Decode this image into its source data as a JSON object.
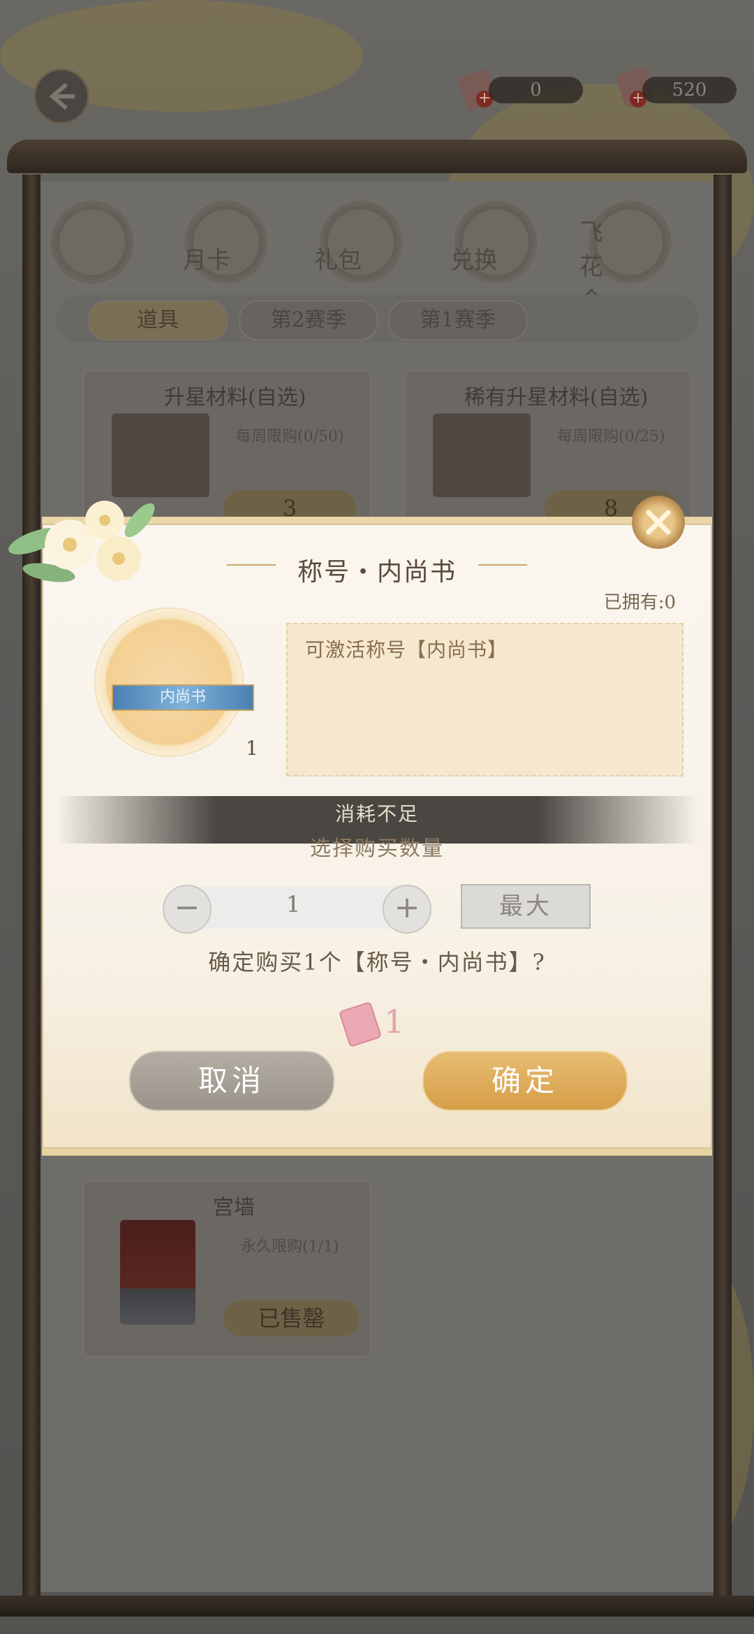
{
  "header": {
    "currency_left": {
      "icon": "ticket-icon",
      "value": "0"
    },
    "currency_right": {
      "icon": "scroll-ticket-icon",
      "value": "520"
    }
  },
  "categories": [
    {
      "label": "",
      "icon": "coin-icon"
    },
    {
      "label": "月卡",
      "icon": "card-icon"
    },
    {
      "label": "礼包",
      "icon": "gift-box-icon"
    },
    {
      "label": "兑换",
      "icon": "exchange-icon"
    },
    {
      "label": "飞花令",
      "icon": "scroll-icon"
    }
  ],
  "tabs": [
    {
      "label": "道具",
      "active": true
    },
    {
      "label": "第2赛季",
      "active": false
    },
    {
      "label": "第1赛季",
      "active": false
    }
  ],
  "shop_items": [
    {
      "title": "升星材料(自选)",
      "limit": "每周限购(0/50)",
      "price": "3"
    },
    {
      "title": "稀有升星材料(自选)",
      "limit": "每周限购(0/25)",
      "price": "8"
    },
    {
      "title": "宫墙",
      "limit": "永久限购(1/1)",
      "price": "已售罄"
    }
  ],
  "dialog": {
    "title": "称号・内尚书",
    "owned": "已拥有:0",
    "item_badge": "内尚书",
    "item_count": "1",
    "description": "可激活称号【内尚书】",
    "toast": "消耗不足",
    "quantity_title": "选择购买数量",
    "minus": "−",
    "plus": "+",
    "quantity": "1",
    "max_label": "最大",
    "confirm_text": "确定购买1个【称号・内尚书】?",
    "cost_value": "1",
    "cancel_label": "取消",
    "ok_label": "确定"
  },
  "colors": {
    "accent_gold": "#d69e48",
    "cancel_gray": "#9b948a",
    "cost_pink": "#e3a4ad"
  }
}
